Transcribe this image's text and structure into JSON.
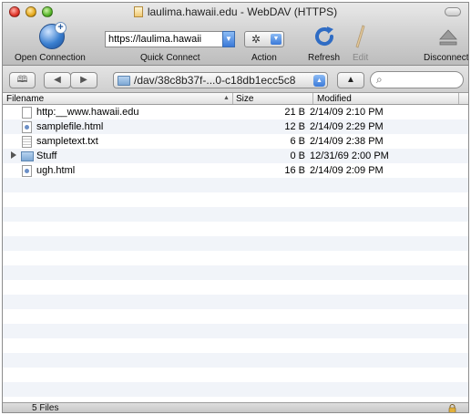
{
  "window": {
    "title": "laulima.hawaii.edu - WebDAV (HTTPS)"
  },
  "toolbar": {
    "open_connection": "Open Connection",
    "quick_connect_value": "https://laulima.hawaii",
    "quick_connect": "Quick Connect",
    "action": "Action",
    "refresh": "Refresh",
    "edit": "Edit",
    "disconnect": "Disconnect"
  },
  "pathbar": {
    "path": "/dav/38c8b37f-...0-c18db1ecc5c8"
  },
  "columns": {
    "filename": "Filename",
    "size": "Size",
    "modified": "Modified"
  },
  "files": [
    {
      "name": "http:__www.hawaii.edu",
      "size": "21 B",
      "modified": "2/14/09 2:10 PM",
      "icon": "generic-file-icon"
    },
    {
      "name": "samplefile.html",
      "size": "12 B",
      "modified": "2/14/09 2:29 PM",
      "icon": "html-file-icon"
    },
    {
      "name": "sampletext.txt",
      "size": "6 B",
      "modified": "2/14/09 2:38 PM",
      "icon": "text-file-icon"
    },
    {
      "name": "Stuff",
      "size": "0 B",
      "modified": "12/31/69 2:00 PM",
      "icon": "folder-icon"
    },
    {
      "name": "ugh.html",
      "size": "16 B",
      "modified": "2/14/09 2:09 PM",
      "icon": "html-file-icon"
    }
  ],
  "status": {
    "file_count": "5 Files"
  },
  "colors": {
    "row_alt": "#f1f4f9",
    "accent_blue": "#3a79d8"
  }
}
